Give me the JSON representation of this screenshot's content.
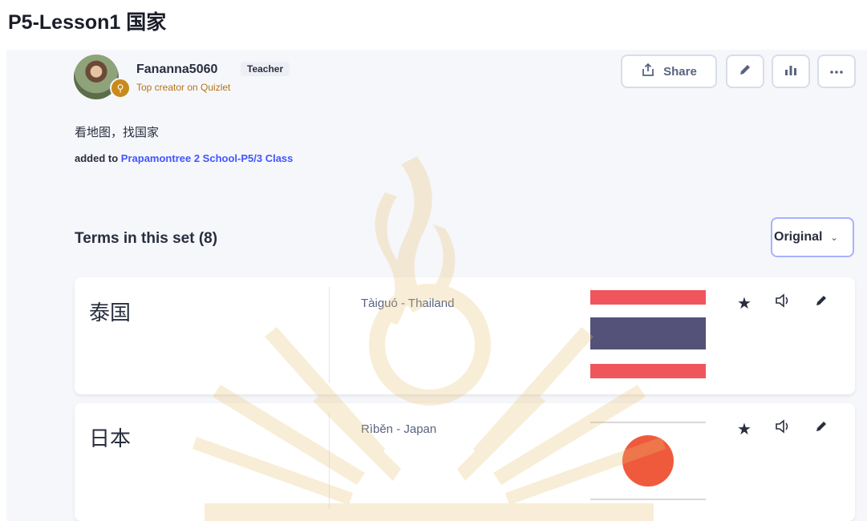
{
  "set_title": "P5-Lesson1 国家",
  "creator": {
    "username": "Fananna5060",
    "role": "Teacher",
    "subtitle": "Top creator on Quizlet"
  },
  "toolbar": {
    "share_label": "Share",
    "share_icon": "share-icon",
    "edit_icon": "pencil-icon",
    "stats_icon": "bar-chart-icon",
    "more_icon": "more-icon"
  },
  "description": "看地图，找国家",
  "added_prefix": "added to",
  "added_class": "Prapamontree 2 School-P5/3 Class",
  "terms_heading": "Terms in this set (8)",
  "sort": {
    "selected": "Original"
  },
  "cards": [
    {
      "term": "泰国",
      "definition": "Tàiguó - Thailand",
      "image": "thailand-flag"
    },
    {
      "term": "日本",
      "definition": "Rìběn - Japan",
      "image": "japan-flag"
    }
  ],
  "colors": {
    "link": "#4255ff",
    "thai_red": "#f0555d",
    "thai_blue": "#545278",
    "japan_red": "#f05a3c",
    "watermark": "#e8c070"
  }
}
